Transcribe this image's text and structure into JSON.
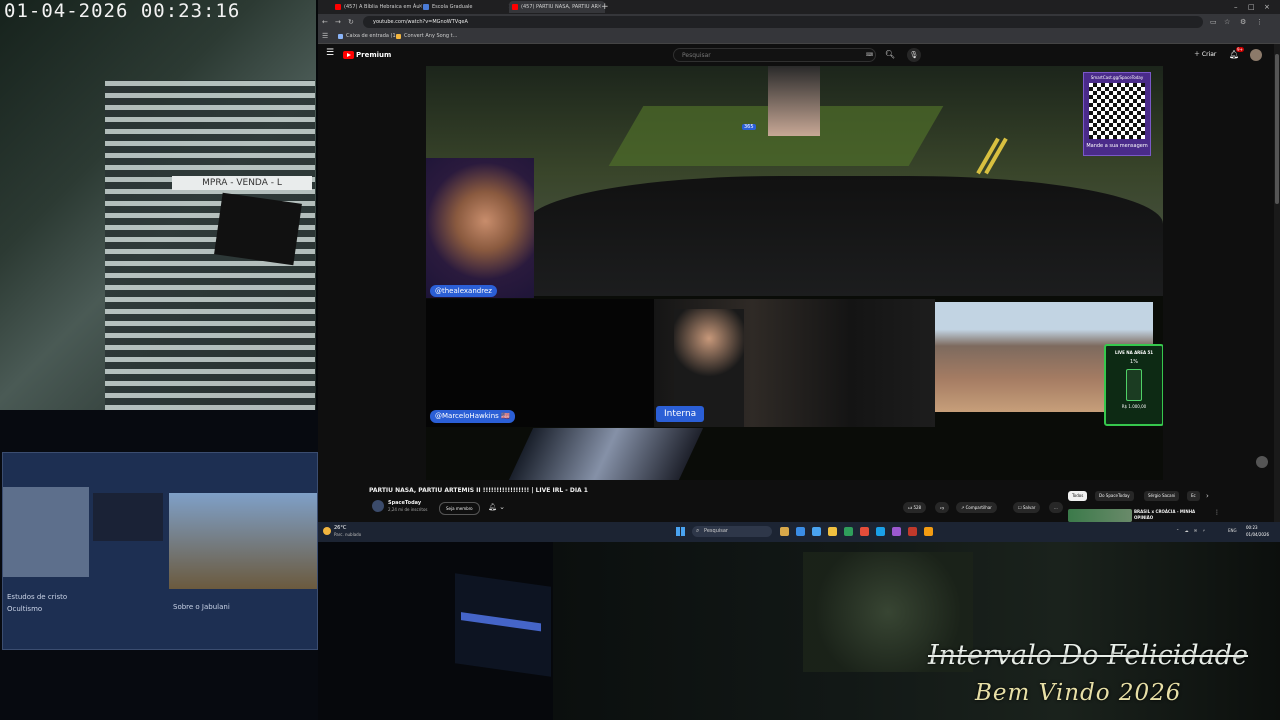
{
  "overlay": {
    "timestamp": "01-04-2026  00:23:16",
    "title": "Intervalo Do Felicidade",
    "subtitle": "Bem Vindo 2026",
    "cam_sign": "MPRA - VENDA - L"
  },
  "browser": {
    "tabs": [
      {
        "label": "(457) A Bíblia Hebraica em Áu",
        "color": "#ff0000"
      },
      {
        "label": "Escola Graduale",
        "color": "#4a7bd6"
      },
      {
        "label": "(457) PARTIU NASA, PARTIU AR",
        "color": "#ff0000"
      }
    ],
    "new_tab": "+",
    "url": "youtube.com/watch?v=MGnoWTVqeA",
    "bookmarks": [
      "Caixa de entrada (1...",
      "Convert Any Song t..."
    ]
  },
  "youtube": {
    "logo_text": "Premium",
    "search_placeholder": "Pesquisar",
    "create_label": "Criar",
    "bell_badge": "9+",
    "video_title": "PARTIU NASA, PARTIU ARTEMIS II !!!!!!!!!!!!!!!!! | LIVE IRL - DIA 1",
    "channel_name": "SpaceToday",
    "channel_subs": "2,24 mi de inscritos",
    "join_label": "Seja membro",
    "like_count": "528",
    "share_label": "Compartilhar",
    "save_label": "Salvar",
    "more_label": "...",
    "chips": [
      "Todos",
      "Do SpaceToday",
      "Sérgio Sacani",
      "Ec"
    ],
    "rec_title": "BRASIL x CROÁCIA - MINHA OPINIÃO"
  },
  "stream": {
    "tag_alex": "@thealexandrez",
    "tag_marcelo": "@MarceloHawkins 🇺🇸",
    "tag_interna": "Interna",
    "qr_header": "SmartCast.gg/SpaceToday",
    "qr_footer": "Mande a sua mensagem",
    "area51_title": "LIVE NA AREA 51",
    "area51_percent": "1%",
    "area51_goal": "R$ 1.000,00",
    "overlay_number": "365"
  },
  "taskbar": {
    "temp": "26°C",
    "weather": "Parc. nublado",
    "search": "Pesquisar",
    "lang": "ENG",
    "time": "00:23",
    "date": "01/04/2026",
    "app_colors": [
      "#d8a84a",
      "#3b8de6",
      "#4aa3f0",
      "#f0c040",
      "#2f9e5b",
      "#e44d3a",
      "#1aa0e8",
      "#9b59d0",
      "#c0392b",
      "#f39c12"
    ]
  },
  "laptop": {
    "texts": [
      "Estudos de cristo",
      "Ocultismo",
      "Sobre o Jabulani"
    ]
  }
}
